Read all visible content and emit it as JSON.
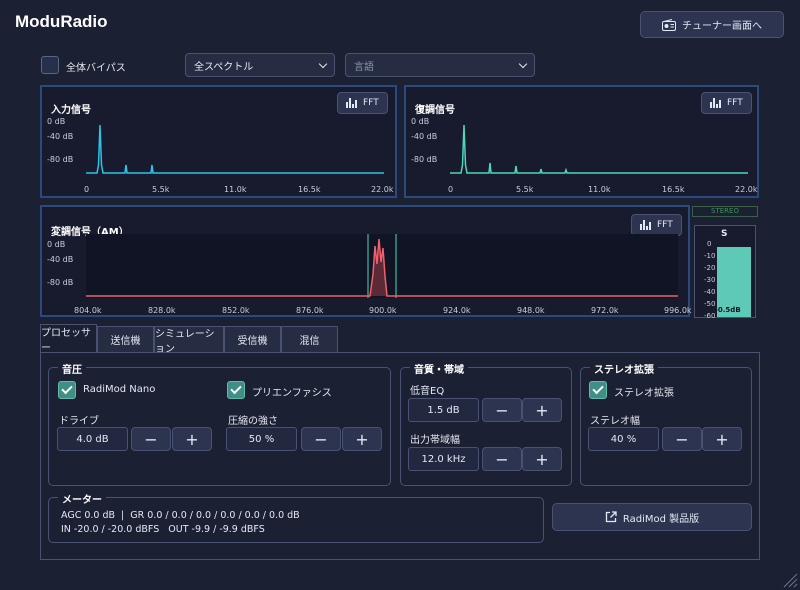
{
  "app": {
    "title": "ModuRadio",
    "tuner_button": "チューナー画面へ"
  },
  "controls": {
    "bypass_label": "全体バイパス",
    "spectrum_select": "全スペクトル",
    "language_placeholder": "言語"
  },
  "input_panel": {
    "title": "入力信号",
    "fft_label": "FFT",
    "y_labels": [
      "0 dB",
      "-40 dB",
      "-80 dB"
    ],
    "x_labels": [
      "0",
      "5.5k",
      "11.0k",
      "16.5k",
      "22.0k"
    ]
  },
  "output_panel": {
    "title": "復調信号",
    "fft_label": "FFT",
    "y_labels": [
      "0 dB",
      "-40 dB",
      "-80 dB"
    ],
    "x_labels": [
      "0",
      "5.5k",
      "11.0k",
      "16.5k",
      "22.0k"
    ]
  },
  "mod_panel": {
    "title": "変調信号（AM）",
    "fft_label": "FFT",
    "y_labels": [
      "0 dB",
      "-40 dB",
      "-80 dB"
    ],
    "x_labels": [
      "804.0k",
      "828.0k",
      "852.0k",
      "876.0k",
      "900.0k",
      "924.0k",
      "948.0k",
      "972.0k",
      "996.0k"
    ]
  },
  "stereo_meter": {
    "badge": "STEREO",
    "channel": "S",
    "scale": [
      "0",
      "-10",
      "-20",
      "-30",
      "-40",
      "-50",
      "-60"
    ],
    "readout": "-0.5dB",
    "level_fraction": 0.94
  },
  "tabs": [
    {
      "label": "プロセッサー"
    },
    {
      "label": "送信機"
    },
    {
      "label": "シミュレーション"
    },
    {
      "label": "受信機"
    },
    {
      "label": "混信"
    }
  ],
  "compression": {
    "title": "音圧",
    "nano_label": "RadiMod Nano",
    "preemphasis_label": "プリエンファシス",
    "drive_label": "ドライブ",
    "drive_value": "4.0 dB",
    "strength_label": "圧縮の強さ",
    "strength_value": "50 %"
  },
  "quality": {
    "title": "音質・帯域",
    "bass_label": "低音EQ",
    "bass_value": "1.5 dB",
    "bandwidth_label": "出力帯域幅",
    "bandwidth_value": "12.0 kHz"
  },
  "stereo": {
    "title": "ステレオ拡張",
    "enable_label": "ステレオ拡張",
    "width_label": "ステレオ幅",
    "width_value": "40 %"
  },
  "meters": {
    "title": "メーター",
    "line1": "AGC 0.0 dB  |  GR 0.0 / 0.0 / 0.0 / 0.0 / 0.0 / 0.0 dB",
    "line2": "IN -20.0 / -20.0 dBFS   OUT -9.9 / -9.9 dBFS"
  },
  "product_button": "RadiMod 製品版",
  "colors": {
    "input_trace": "#2ec4e8",
    "output_trace": "#4fd6b8",
    "mod_trace": "#f0606c",
    "meter_fill": "#5fc9b8"
  }
}
